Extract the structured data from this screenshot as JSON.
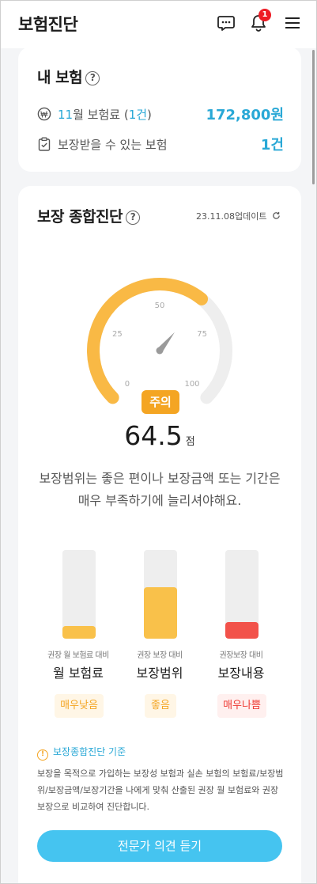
{
  "header": {
    "title": "보험진단",
    "notification_count": "1",
    "icons": [
      "chat-icon",
      "bell-icon",
      "menu-icon"
    ]
  },
  "my_insurance": {
    "title": "내 보험",
    "help": "?",
    "premium_month": "11",
    "premium_label_mid": "월 보험료 (",
    "premium_count": "1건",
    "premium_label_end": ")",
    "premium_value": "172,800원",
    "coverage_label": "보장받을 수 있는 보험",
    "coverage_value": "1건"
  },
  "diagnosis": {
    "title": "보장 종합진단",
    "help": "?",
    "updated": "23.11.08업데이트",
    "gauge": {
      "ticks": [
        "0",
        "25",
        "50",
        "75",
        "100"
      ],
      "value": 64.5,
      "max": 100
    },
    "status_badge": "주의",
    "score": "64.5",
    "score_unit": "점",
    "description": "보장범위는 좋은 편이나 보장금액 또는 기간은 매우 부족하기에 늘리셔야해요.",
    "bars": [
      {
        "caption": "권장 월 보험료 대비",
        "name": "월 보험료",
        "tag": "매우낮음",
        "level": 0.14,
        "fill_color": "#f9c14a",
        "tag_color": "#f4a523",
        "tag_bg": "#fff6e6"
      },
      {
        "caption": "권장 보장 대비",
        "name": "보장범위",
        "tag": "좋음",
        "level": 0.58,
        "fill_color": "#f9c14a",
        "tag_color": "#f4a523",
        "tag_bg": "#fff6e6"
      },
      {
        "caption": "권장보장 대비",
        "name": "보장내용",
        "tag": "매우나쁨",
        "level": 0.19,
        "fill_color": "#f2524a",
        "tag_color": "#ee3b34",
        "tag_bg": "#fff0ef"
      }
    ],
    "criteria_title": "보장종합진단 기준",
    "criteria_text": "보장을 목적으로 가입하는 보장성 보험과 실손 보험의 보험료/보장범위/보장금액/보장기간을 나에게 맞춰 산출된 권장 월 보험료와 권장 보장으로 비교하여 진단합니다.",
    "cta": "전문가 의견 듣기"
  },
  "colors": {
    "accent_blue": "#29a8d6",
    "gauge_orange": "#f9b945",
    "gauge_track": "#eeeeee",
    "cta_blue": "#45c4f0"
  }
}
